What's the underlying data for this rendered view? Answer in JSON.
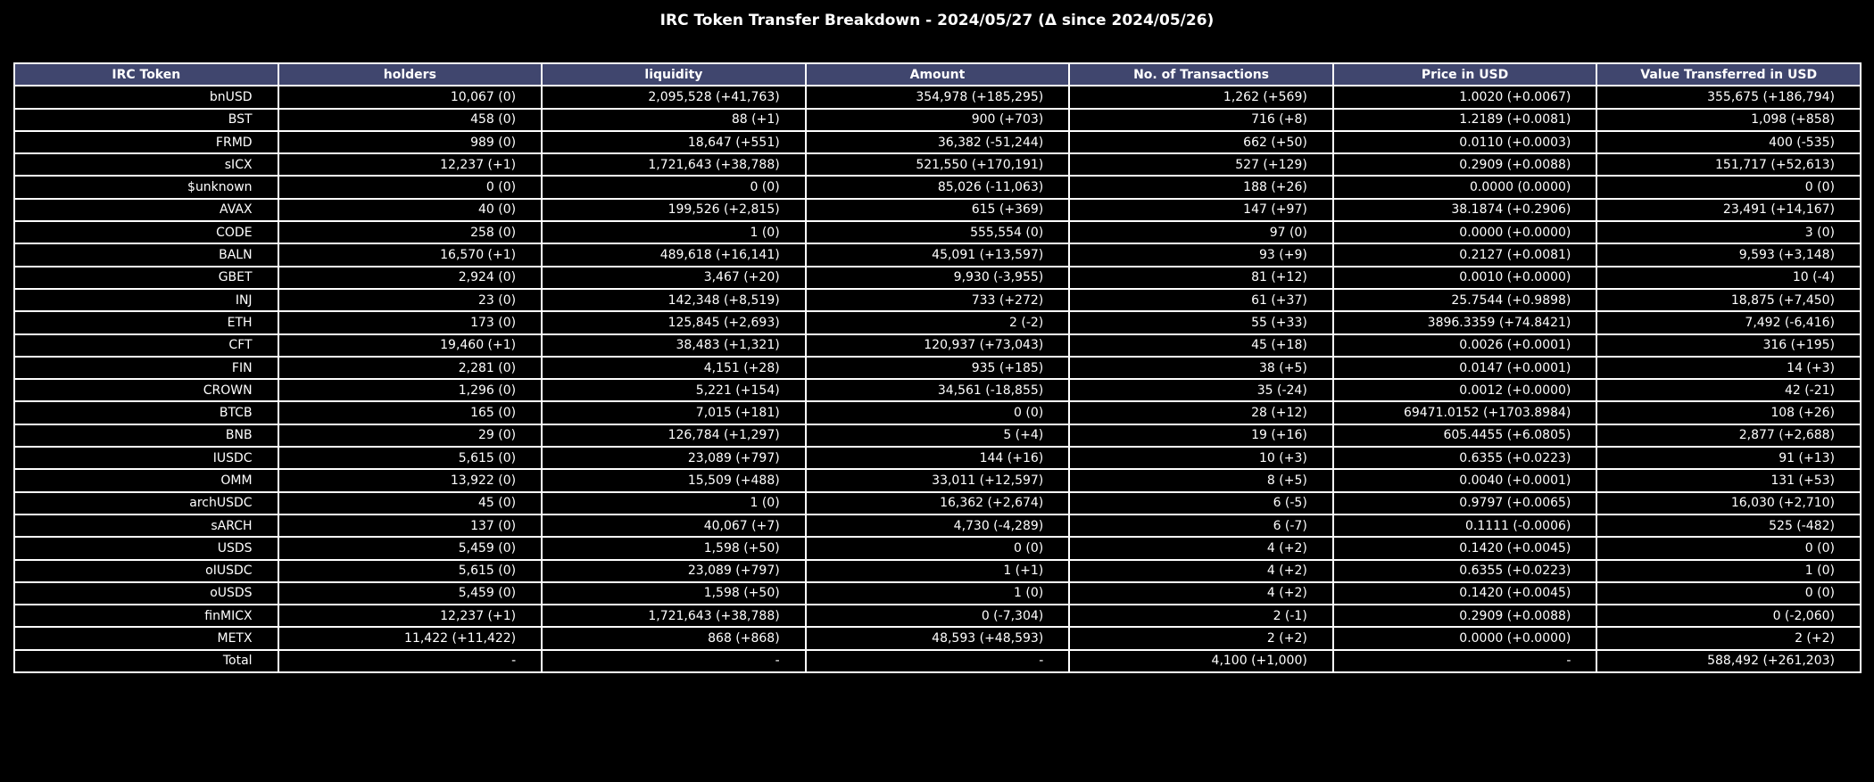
{
  "chart_data": {
    "type": "table",
    "title": "IRC Token Transfer Breakdown - 2024/05/27 (Δ since 2024/05/26)",
    "header_color": "#40466e",
    "columns": [
      "IRC Token",
      "holders",
      "liquidity",
      "Amount",
      "No. of Transactions",
      "Price in USD",
      "Value Transferred in USD"
    ],
    "rows": [
      [
        "bnUSD",
        "10,067 (0)",
        "2,095,528 (+41,763)",
        "354,978 (+185,295)",
        "1,262 (+569)",
        "1.0020 (+0.0067)",
        "355,675 (+186,794)"
      ],
      [
        "BST",
        "458 (0)",
        "88 (+1)",
        "900 (+703)",
        "716 (+8)",
        "1.2189 (+0.0081)",
        "1,098 (+858)"
      ],
      [
        "FRMD",
        "989 (0)",
        "18,647 (+551)",
        "36,382 (-51,244)",
        "662 (+50)",
        "0.0110 (+0.0003)",
        "400 (-535)"
      ],
      [
        "sICX",
        "12,237 (+1)",
        "1,721,643 (+38,788)",
        "521,550 (+170,191)",
        "527 (+129)",
        "0.2909 (+0.0088)",
        "151,717 (+52,613)"
      ],
      [
        "$unknown",
        "0 (0)",
        "0 (0)",
        "85,026 (-11,063)",
        "188 (+26)",
        "0.0000 (0.0000)",
        "0 (0)"
      ],
      [
        "AVAX",
        "40 (0)",
        "199,526 (+2,815)",
        "615 (+369)",
        "147 (+97)",
        "38.1874 (+0.2906)",
        "23,491 (+14,167)"
      ],
      [
        "CODE",
        "258 (0)",
        "1 (0)",
        "555,554 (0)",
        "97 (0)",
        "0.0000 (+0.0000)",
        "3 (0)"
      ],
      [
        "BALN",
        "16,570 (+1)",
        "489,618 (+16,141)",
        "45,091 (+13,597)",
        "93 (+9)",
        "0.2127 (+0.0081)",
        "9,593 (+3,148)"
      ],
      [
        "GBET",
        "2,924 (0)",
        "3,467 (+20)",
        "9,930 (-3,955)",
        "81 (+12)",
        "0.0010 (+0.0000)",
        "10 (-4)"
      ],
      [
        "INJ",
        "23 (0)",
        "142,348 (+8,519)",
        "733 (+272)",
        "61 (+37)",
        "25.7544 (+0.9898)",
        "18,875 (+7,450)"
      ],
      [
        "ETH",
        "173 (0)",
        "125,845 (+2,693)",
        "2 (-2)",
        "55 (+33)",
        "3896.3359 (+74.8421)",
        "7,492 (-6,416)"
      ],
      [
        "CFT",
        "19,460 (+1)",
        "38,483 (+1,321)",
        "120,937 (+73,043)",
        "45 (+18)",
        "0.0026 (+0.0001)",
        "316 (+195)"
      ],
      [
        "FIN",
        "2,281 (0)",
        "4,151 (+28)",
        "935 (+185)",
        "38 (+5)",
        "0.0147 (+0.0001)",
        "14 (+3)"
      ],
      [
        "CROWN",
        "1,296 (0)",
        "5,221 (+154)",
        "34,561 (-18,855)",
        "35 (-24)",
        "0.0012 (+0.0000)",
        "42 (-21)"
      ],
      [
        "BTCB",
        "165 (0)",
        "7,015 (+181)",
        "0 (0)",
        "28 (+12)",
        "69471.0152 (+1703.8984)",
        "108 (+26)"
      ],
      [
        "BNB",
        "29 (0)",
        "126,784 (+1,297)",
        "5 (+4)",
        "19 (+16)",
        "605.4455 (+6.0805)",
        "2,877 (+2,688)"
      ],
      [
        "IUSDC",
        "5,615 (0)",
        "23,089 (+797)",
        "144 (+16)",
        "10 (+3)",
        "0.6355 (+0.0223)",
        "91 (+13)"
      ],
      [
        "OMM",
        "13,922 (0)",
        "15,509 (+488)",
        "33,011 (+12,597)",
        "8 (+5)",
        "0.0040 (+0.0001)",
        "131 (+53)"
      ],
      [
        "archUSDC",
        "45 (0)",
        "1 (0)",
        "16,362 (+2,674)",
        "6 (-5)",
        "0.9797 (+0.0065)",
        "16,030 (+2,710)"
      ],
      [
        "sARCH",
        "137 (0)",
        "40,067 (+7)",
        "4,730 (-4,289)",
        "6 (-7)",
        "0.1111 (-0.0006)",
        "525 (-482)"
      ],
      [
        "USDS",
        "5,459 (0)",
        "1,598 (+50)",
        "0 (0)",
        "4 (+2)",
        "0.1420 (+0.0045)",
        "0 (0)"
      ],
      [
        "oIUSDC",
        "5,615 (0)",
        "23,089 (+797)",
        "1 (+1)",
        "4 (+2)",
        "0.6355 (+0.0223)",
        "1 (0)"
      ],
      [
        "oUSDS",
        "5,459 (0)",
        "1,598 (+50)",
        "1 (0)",
        "4 (+2)",
        "0.1420 (+0.0045)",
        "0 (0)"
      ],
      [
        "finMICX",
        "12,237 (+1)",
        "1,721,643 (+38,788)",
        "0 (-7,304)",
        "2 (-1)",
        "0.2909 (+0.0088)",
        "0 (-2,060)"
      ],
      [
        "METX",
        "11,422 (+11,422)",
        "868 (+868)",
        "48,593 (+48,593)",
        "2 (+2)",
        "0.0000 (+0.0000)",
        "2 (+2)"
      ],
      [
        "Total",
        "-",
        "-",
        "-",
        "4,100 (+1,000)",
        "-",
        "588,492 (+261,203)"
      ]
    ]
  }
}
